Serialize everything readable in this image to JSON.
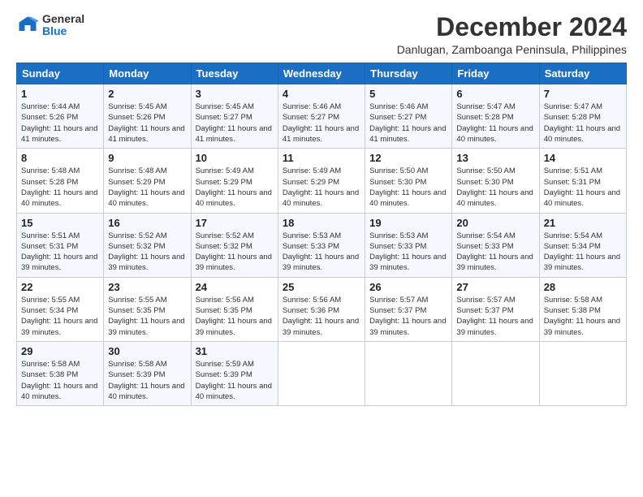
{
  "logo": {
    "general": "General",
    "blue": "Blue"
  },
  "header": {
    "month": "December 2024",
    "location": "Danlugan, Zamboanga Peninsula, Philippines"
  },
  "weekdays": [
    "Sunday",
    "Monday",
    "Tuesday",
    "Wednesday",
    "Thursday",
    "Friday",
    "Saturday"
  ],
  "weeks": [
    [
      {
        "day": "1",
        "sunrise": "5:44 AM",
        "sunset": "5:26 PM",
        "daylight": "11 hours and 41 minutes."
      },
      {
        "day": "2",
        "sunrise": "5:45 AM",
        "sunset": "5:26 PM",
        "daylight": "11 hours and 41 minutes."
      },
      {
        "day": "3",
        "sunrise": "5:45 AM",
        "sunset": "5:27 PM",
        "daylight": "11 hours and 41 minutes."
      },
      {
        "day": "4",
        "sunrise": "5:46 AM",
        "sunset": "5:27 PM",
        "daylight": "11 hours and 41 minutes."
      },
      {
        "day": "5",
        "sunrise": "5:46 AM",
        "sunset": "5:27 PM",
        "daylight": "11 hours and 41 minutes."
      },
      {
        "day": "6",
        "sunrise": "5:47 AM",
        "sunset": "5:28 PM",
        "daylight": "11 hours and 40 minutes."
      },
      {
        "day": "7",
        "sunrise": "5:47 AM",
        "sunset": "5:28 PM",
        "daylight": "11 hours and 40 minutes."
      }
    ],
    [
      {
        "day": "8",
        "sunrise": "5:48 AM",
        "sunset": "5:28 PM",
        "daylight": "11 hours and 40 minutes."
      },
      {
        "day": "9",
        "sunrise": "5:48 AM",
        "sunset": "5:29 PM",
        "daylight": "11 hours and 40 minutes."
      },
      {
        "day": "10",
        "sunrise": "5:49 AM",
        "sunset": "5:29 PM",
        "daylight": "11 hours and 40 minutes."
      },
      {
        "day": "11",
        "sunrise": "5:49 AM",
        "sunset": "5:29 PM",
        "daylight": "11 hours and 40 minutes."
      },
      {
        "day": "12",
        "sunrise": "5:50 AM",
        "sunset": "5:30 PM",
        "daylight": "11 hours and 40 minutes."
      },
      {
        "day": "13",
        "sunrise": "5:50 AM",
        "sunset": "5:30 PM",
        "daylight": "11 hours and 40 minutes."
      },
      {
        "day": "14",
        "sunrise": "5:51 AM",
        "sunset": "5:31 PM",
        "daylight": "11 hours and 40 minutes."
      }
    ],
    [
      {
        "day": "15",
        "sunrise": "5:51 AM",
        "sunset": "5:31 PM",
        "daylight": "11 hours and 39 minutes."
      },
      {
        "day": "16",
        "sunrise": "5:52 AM",
        "sunset": "5:32 PM",
        "daylight": "11 hours and 39 minutes."
      },
      {
        "day": "17",
        "sunrise": "5:52 AM",
        "sunset": "5:32 PM",
        "daylight": "11 hours and 39 minutes."
      },
      {
        "day": "18",
        "sunrise": "5:53 AM",
        "sunset": "5:33 PM",
        "daylight": "11 hours and 39 minutes."
      },
      {
        "day": "19",
        "sunrise": "5:53 AM",
        "sunset": "5:33 PM",
        "daylight": "11 hours and 39 minutes."
      },
      {
        "day": "20",
        "sunrise": "5:54 AM",
        "sunset": "5:33 PM",
        "daylight": "11 hours and 39 minutes."
      },
      {
        "day": "21",
        "sunrise": "5:54 AM",
        "sunset": "5:34 PM",
        "daylight": "11 hours and 39 minutes."
      }
    ],
    [
      {
        "day": "22",
        "sunrise": "5:55 AM",
        "sunset": "5:34 PM",
        "daylight": "11 hours and 39 minutes."
      },
      {
        "day": "23",
        "sunrise": "5:55 AM",
        "sunset": "5:35 PM",
        "daylight": "11 hours and 39 minutes."
      },
      {
        "day": "24",
        "sunrise": "5:56 AM",
        "sunset": "5:35 PM",
        "daylight": "11 hours and 39 minutes."
      },
      {
        "day": "25",
        "sunrise": "5:56 AM",
        "sunset": "5:36 PM",
        "daylight": "11 hours and 39 minutes."
      },
      {
        "day": "26",
        "sunrise": "5:57 AM",
        "sunset": "5:37 PM",
        "daylight": "11 hours and 39 minutes."
      },
      {
        "day": "27",
        "sunrise": "5:57 AM",
        "sunset": "5:37 PM",
        "daylight": "11 hours and 39 minutes."
      },
      {
        "day": "28",
        "sunrise": "5:58 AM",
        "sunset": "5:38 PM",
        "daylight": "11 hours and 39 minutes."
      }
    ],
    [
      {
        "day": "29",
        "sunrise": "5:58 AM",
        "sunset": "5:38 PM",
        "daylight": "11 hours and 40 minutes."
      },
      {
        "day": "30",
        "sunrise": "5:58 AM",
        "sunset": "5:39 PM",
        "daylight": "11 hours and 40 minutes."
      },
      {
        "day": "31",
        "sunrise": "5:59 AM",
        "sunset": "5:39 PM",
        "daylight": "11 hours and 40 minutes."
      },
      null,
      null,
      null,
      null
    ]
  ],
  "labels": {
    "sunrise": "Sunrise:",
    "sunset": "Sunset:",
    "daylight": "Daylight:"
  }
}
